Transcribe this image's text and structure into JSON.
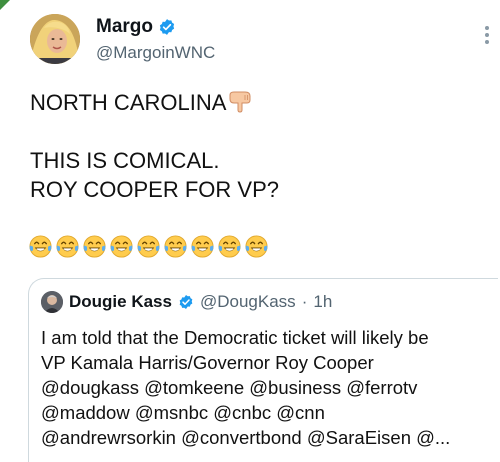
{
  "author": {
    "display_name": "Margo",
    "handle": "@MargoinWNC"
  },
  "post": {
    "line1": "NORTH CAROLINA",
    "line2": "THIS IS COMICAL.",
    "line3": "ROY COOPER FOR VP?",
    "pointing_emoji": "backhand-index-pointing-down",
    "laughing_emoji_count": 9
  },
  "quoted": {
    "display_name": "Dougie Kass",
    "handle": "@DougKass",
    "separator": "·",
    "time": "1h",
    "lines": [
      "I am told that the Democratic ticket will likely be",
      "VP Kamala Harris/Governor Roy Cooper",
      "@dougkass @tomkeene @business @ferrotv",
      "@maddow @msnbc @cnbc @cnn",
      "@andrewrsorkin @convertbond @SaraEisen @..."
    ]
  },
  "colors": {
    "verified": "#1d9bf0",
    "secondary_text": "#536471",
    "border": "#cfd9de"
  }
}
